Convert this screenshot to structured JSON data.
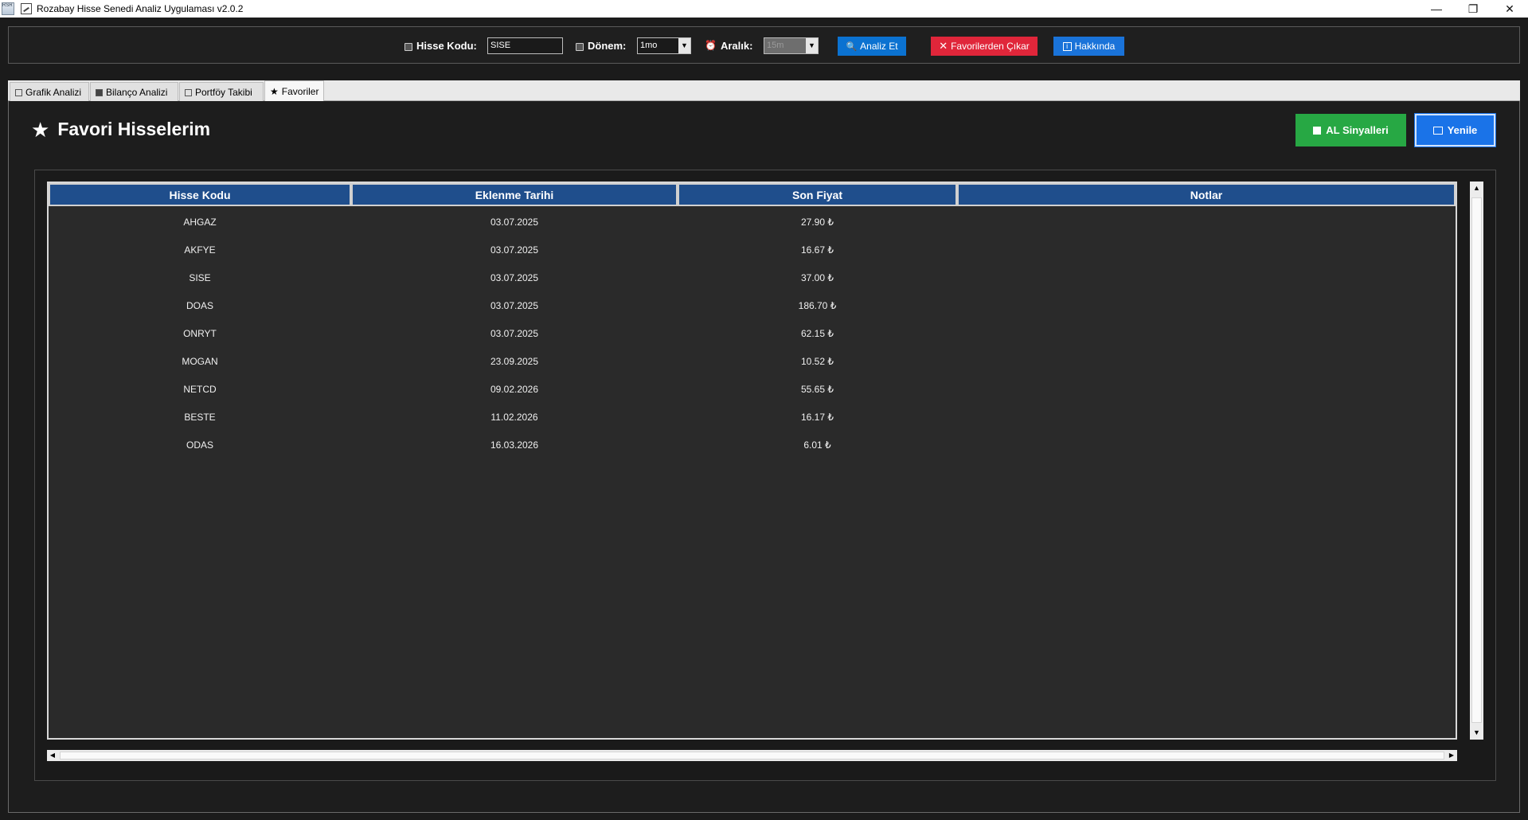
{
  "window": {
    "title": "Rozabay Hisse Senedi Analiz Uygulaması v2.0.2",
    "app_icon_text": "RSR",
    "minimize": "—",
    "restore": "❐",
    "close": "✕"
  },
  "toolbar": {
    "hisse_label": "Hisse Kodu:",
    "hisse_value": "SISE",
    "donem_label": "Dönem:",
    "donem_value": "1mo",
    "aralik_label": "Aralık:",
    "aralik_value": "15m",
    "analiz_label": "Analiz Et",
    "favori_cikar_label": "Favorilerden Çıkar",
    "hakkinda_label": "Hakkında"
  },
  "tabs": [
    {
      "label": "Grafik Analizi"
    },
    {
      "label": "Bilanço Analizi"
    },
    {
      "label": "Portföy Takibi"
    },
    {
      "label": "Favoriler"
    }
  ],
  "favorites": {
    "title": "Favori Hisselerim",
    "al_label": "AL Sinyalleri",
    "yenile_label": "Yenile",
    "columns": [
      "Hisse Kodu",
      "Eklenme Tarihi",
      "Son Fiyat",
      "Notlar"
    ],
    "rows": [
      {
        "code": "AHGAZ",
        "date": "03.07.2025",
        "price": "27.90 ₺",
        "note": ""
      },
      {
        "code": "AKFYE",
        "date": "03.07.2025",
        "price": "16.67 ₺",
        "note": ""
      },
      {
        "code": "SISE",
        "date": "03.07.2025",
        "price": "37.00 ₺",
        "note": ""
      },
      {
        "code": "DOAS",
        "date": "03.07.2025",
        "price": "186.70 ₺",
        "note": ""
      },
      {
        "code": "ONRYT",
        "date": "03.07.2025",
        "price": "62.15 ₺",
        "note": ""
      },
      {
        "code": "MOGAN",
        "date": "23.09.2025",
        "price": "10.52 ₺",
        "note": ""
      },
      {
        "code": "NETCD",
        "date": "09.02.2026",
        "price": "55.65 ₺",
        "note": ""
      },
      {
        "code": "BESTE",
        "date": "11.02.2026",
        "price": "16.17 ₺",
        "note": ""
      },
      {
        "code": "ODAS",
        "date": "16.03.2026",
        "price": "6.01 ₺",
        "note": ""
      }
    ]
  },
  "colors": {
    "header_blue": "#1f4e8c",
    "al_green": "#27a844",
    "yenile_blue": "#1a73e8",
    "analiz_blue": "#0b72d1",
    "cikar_red": "#e0263a",
    "hakkinda_blue": "#1a73d9"
  }
}
